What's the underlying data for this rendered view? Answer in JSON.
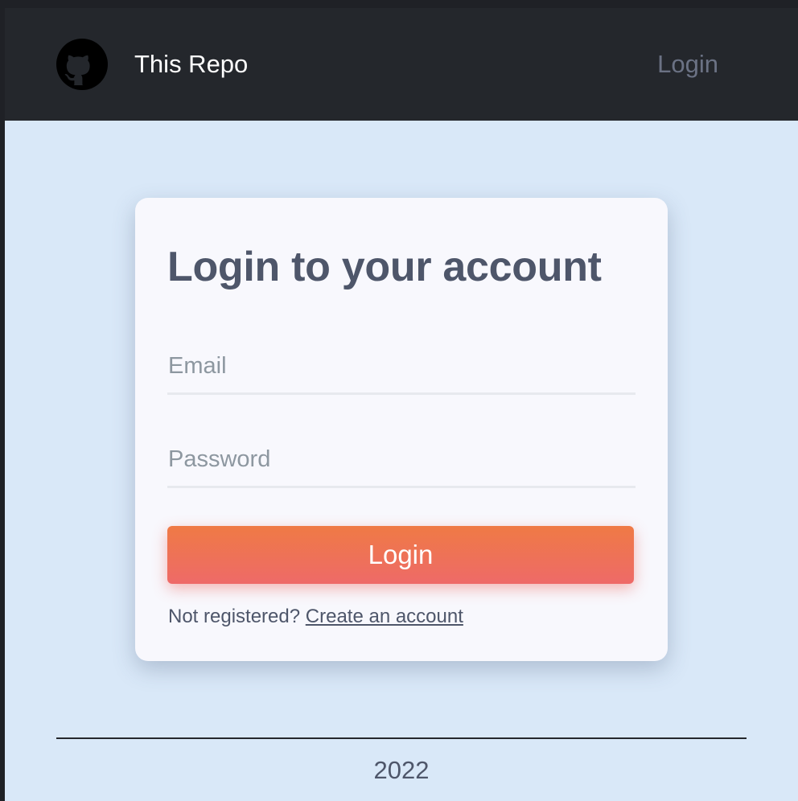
{
  "header": {
    "logo_icon": "github-icon",
    "title": "This Repo",
    "nav_login": "Login"
  },
  "login_card": {
    "title": "Login to your account",
    "email_placeholder": "Email",
    "email_value": "",
    "password_placeholder": "Password",
    "password_value": "",
    "submit_label": "Login",
    "register_prompt": "Not registered?",
    "register_link": "Create an account"
  },
  "footer": {
    "year": "2022"
  },
  "colors": {
    "header_bg": "#24272c",
    "page_bg": "#d9e8f8",
    "card_bg": "#f8f8fd",
    "text": "#4e566a",
    "button_top": "#ef7a45",
    "button_bottom": "#ee6a68"
  }
}
